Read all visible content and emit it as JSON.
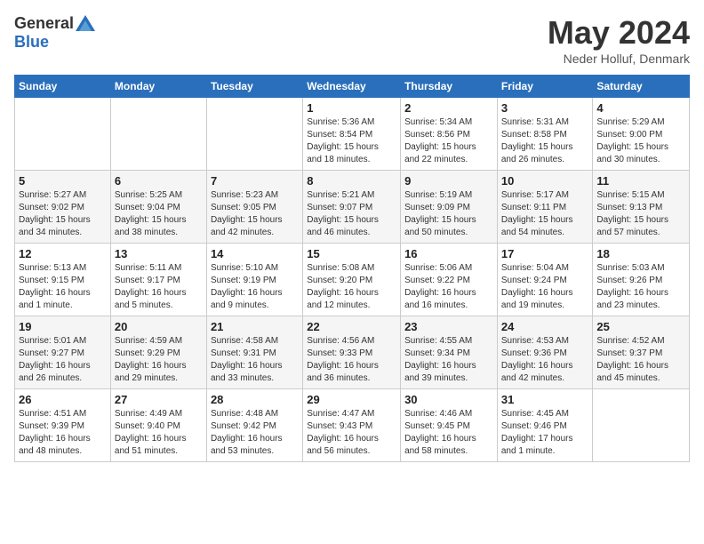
{
  "header": {
    "logo_general": "General",
    "logo_blue": "Blue",
    "title": "May 2024",
    "location": "Neder Holluf, Denmark"
  },
  "calendar": {
    "weekdays": [
      "Sunday",
      "Monday",
      "Tuesday",
      "Wednesday",
      "Thursday",
      "Friday",
      "Saturday"
    ],
    "weeks": [
      [
        {
          "day": "",
          "info": ""
        },
        {
          "day": "",
          "info": ""
        },
        {
          "day": "",
          "info": ""
        },
        {
          "day": "1",
          "info": "Sunrise: 5:36 AM\nSunset: 8:54 PM\nDaylight: 15 hours\nand 18 minutes."
        },
        {
          "day": "2",
          "info": "Sunrise: 5:34 AM\nSunset: 8:56 PM\nDaylight: 15 hours\nand 22 minutes."
        },
        {
          "day": "3",
          "info": "Sunrise: 5:31 AM\nSunset: 8:58 PM\nDaylight: 15 hours\nand 26 minutes."
        },
        {
          "day": "4",
          "info": "Sunrise: 5:29 AM\nSunset: 9:00 PM\nDaylight: 15 hours\nand 30 minutes."
        }
      ],
      [
        {
          "day": "5",
          "info": "Sunrise: 5:27 AM\nSunset: 9:02 PM\nDaylight: 15 hours\nand 34 minutes."
        },
        {
          "day": "6",
          "info": "Sunrise: 5:25 AM\nSunset: 9:04 PM\nDaylight: 15 hours\nand 38 minutes."
        },
        {
          "day": "7",
          "info": "Sunrise: 5:23 AM\nSunset: 9:05 PM\nDaylight: 15 hours\nand 42 minutes."
        },
        {
          "day": "8",
          "info": "Sunrise: 5:21 AM\nSunset: 9:07 PM\nDaylight: 15 hours\nand 46 minutes."
        },
        {
          "day": "9",
          "info": "Sunrise: 5:19 AM\nSunset: 9:09 PM\nDaylight: 15 hours\nand 50 minutes."
        },
        {
          "day": "10",
          "info": "Sunrise: 5:17 AM\nSunset: 9:11 PM\nDaylight: 15 hours\nand 54 minutes."
        },
        {
          "day": "11",
          "info": "Sunrise: 5:15 AM\nSunset: 9:13 PM\nDaylight: 15 hours\nand 57 minutes."
        }
      ],
      [
        {
          "day": "12",
          "info": "Sunrise: 5:13 AM\nSunset: 9:15 PM\nDaylight: 16 hours\nand 1 minute."
        },
        {
          "day": "13",
          "info": "Sunrise: 5:11 AM\nSunset: 9:17 PM\nDaylight: 16 hours\nand 5 minutes."
        },
        {
          "day": "14",
          "info": "Sunrise: 5:10 AM\nSunset: 9:19 PM\nDaylight: 16 hours\nand 9 minutes."
        },
        {
          "day": "15",
          "info": "Sunrise: 5:08 AM\nSunset: 9:20 PM\nDaylight: 16 hours\nand 12 minutes."
        },
        {
          "day": "16",
          "info": "Sunrise: 5:06 AM\nSunset: 9:22 PM\nDaylight: 16 hours\nand 16 minutes."
        },
        {
          "day": "17",
          "info": "Sunrise: 5:04 AM\nSunset: 9:24 PM\nDaylight: 16 hours\nand 19 minutes."
        },
        {
          "day": "18",
          "info": "Sunrise: 5:03 AM\nSunset: 9:26 PM\nDaylight: 16 hours\nand 23 minutes."
        }
      ],
      [
        {
          "day": "19",
          "info": "Sunrise: 5:01 AM\nSunset: 9:27 PM\nDaylight: 16 hours\nand 26 minutes."
        },
        {
          "day": "20",
          "info": "Sunrise: 4:59 AM\nSunset: 9:29 PM\nDaylight: 16 hours\nand 29 minutes."
        },
        {
          "day": "21",
          "info": "Sunrise: 4:58 AM\nSunset: 9:31 PM\nDaylight: 16 hours\nand 33 minutes."
        },
        {
          "day": "22",
          "info": "Sunrise: 4:56 AM\nSunset: 9:33 PM\nDaylight: 16 hours\nand 36 minutes."
        },
        {
          "day": "23",
          "info": "Sunrise: 4:55 AM\nSunset: 9:34 PM\nDaylight: 16 hours\nand 39 minutes."
        },
        {
          "day": "24",
          "info": "Sunrise: 4:53 AM\nSunset: 9:36 PM\nDaylight: 16 hours\nand 42 minutes."
        },
        {
          "day": "25",
          "info": "Sunrise: 4:52 AM\nSunset: 9:37 PM\nDaylight: 16 hours\nand 45 minutes."
        }
      ],
      [
        {
          "day": "26",
          "info": "Sunrise: 4:51 AM\nSunset: 9:39 PM\nDaylight: 16 hours\nand 48 minutes."
        },
        {
          "day": "27",
          "info": "Sunrise: 4:49 AM\nSunset: 9:40 PM\nDaylight: 16 hours\nand 51 minutes."
        },
        {
          "day": "28",
          "info": "Sunrise: 4:48 AM\nSunset: 9:42 PM\nDaylight: 16 hours\nand 53 minutes."
        },
        {
          "day": "29",
          "info": "Sunrise: 4:47 AM\nSunset: 9:43 PM\nDaylight: 16 hours\nand 56 minutes."
        },
        {
          "day": "30",
          "info": "Sunrise: 4:46 AM\nSunset: 9:45 PM\nDaylight: 16 hours\nand 58 minutes."
        },
        {
          "day": "31",
          "info": "Sunrise: 4:45 AM\nSunset: 9:46 PM\nDaylight: 17 hours\nand 1 minute."
        },
        {
          "day": "",
          "info": ""
        }
      ]
    ]
  }
}
